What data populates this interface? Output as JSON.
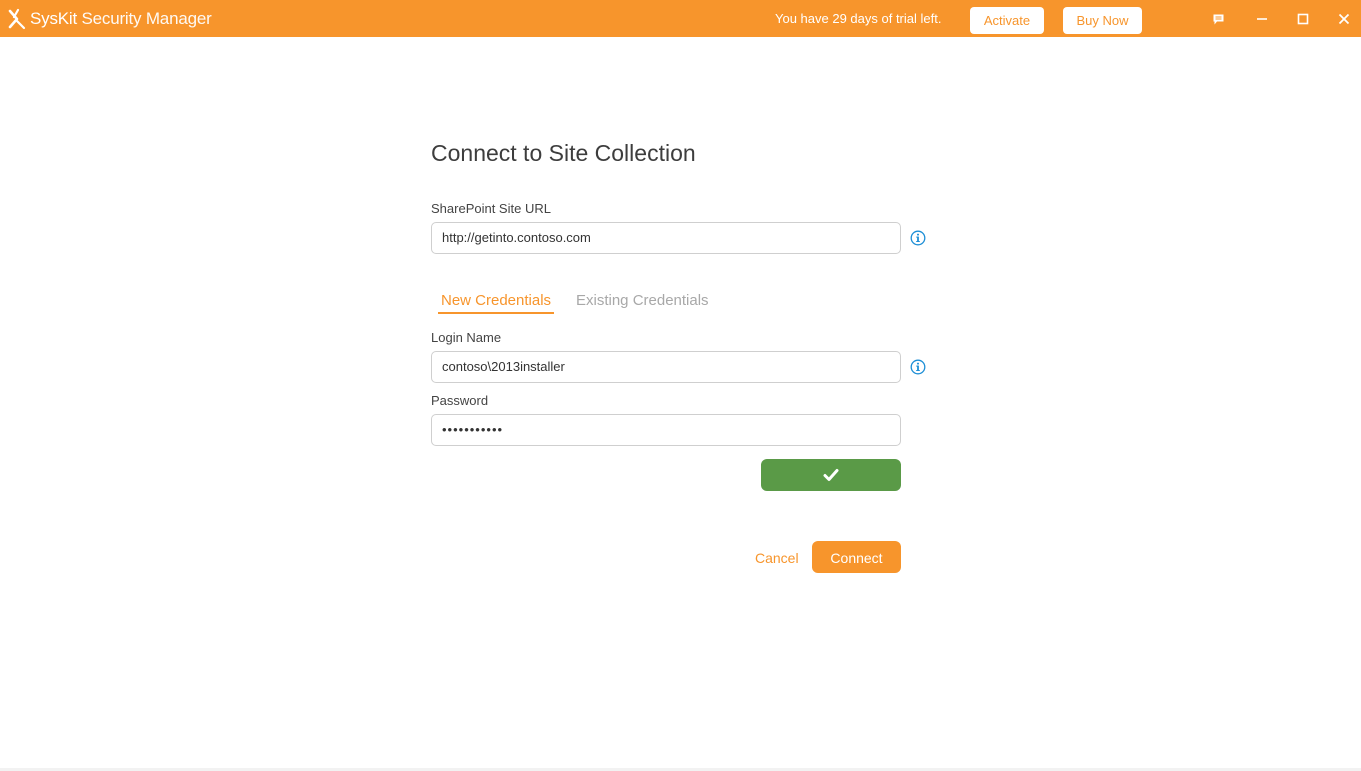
{
  "app": {
    "brand_name": "SysKit",
    "product_name": "Security Manager",
    "trial_message": "You have 29 days of trial left.",
    "activate_label": "Activate",
    "buy_now_label": "Buy Now",
    "icons": [
      "chat-icon",
      "minimize-icon",
      "maximize-icon",
      "close-icon"
    ]
  },
  "dialog": {
    "title": "Connect to Site Collection",
    "site_url": {
      "label": "SharePoint Site URL",
      "value": "http://getinto.contoso.com"
    },
    "tabs": [
      {
        "label": "New Credentials",
        "active": true
      },
      {
        "label": "Existing Credentials",
        "active": false
      }
    ],
    "login": {
      "label": "Login Name",
      "value": "contoso\\2013installer"
    },
    "password": {
      "label": "Password",
      "masked_value": "•••••••••••"
    },
    "validate_icon": "checkmark-icon",
    "cancel_label": "Cancel",
    "connect_label": "Connect"
  },
  "colors": {
    "accent": "#f7952c",
    "success": "#5a9a47",
    "info": "#1e8fd6"
  }
}
